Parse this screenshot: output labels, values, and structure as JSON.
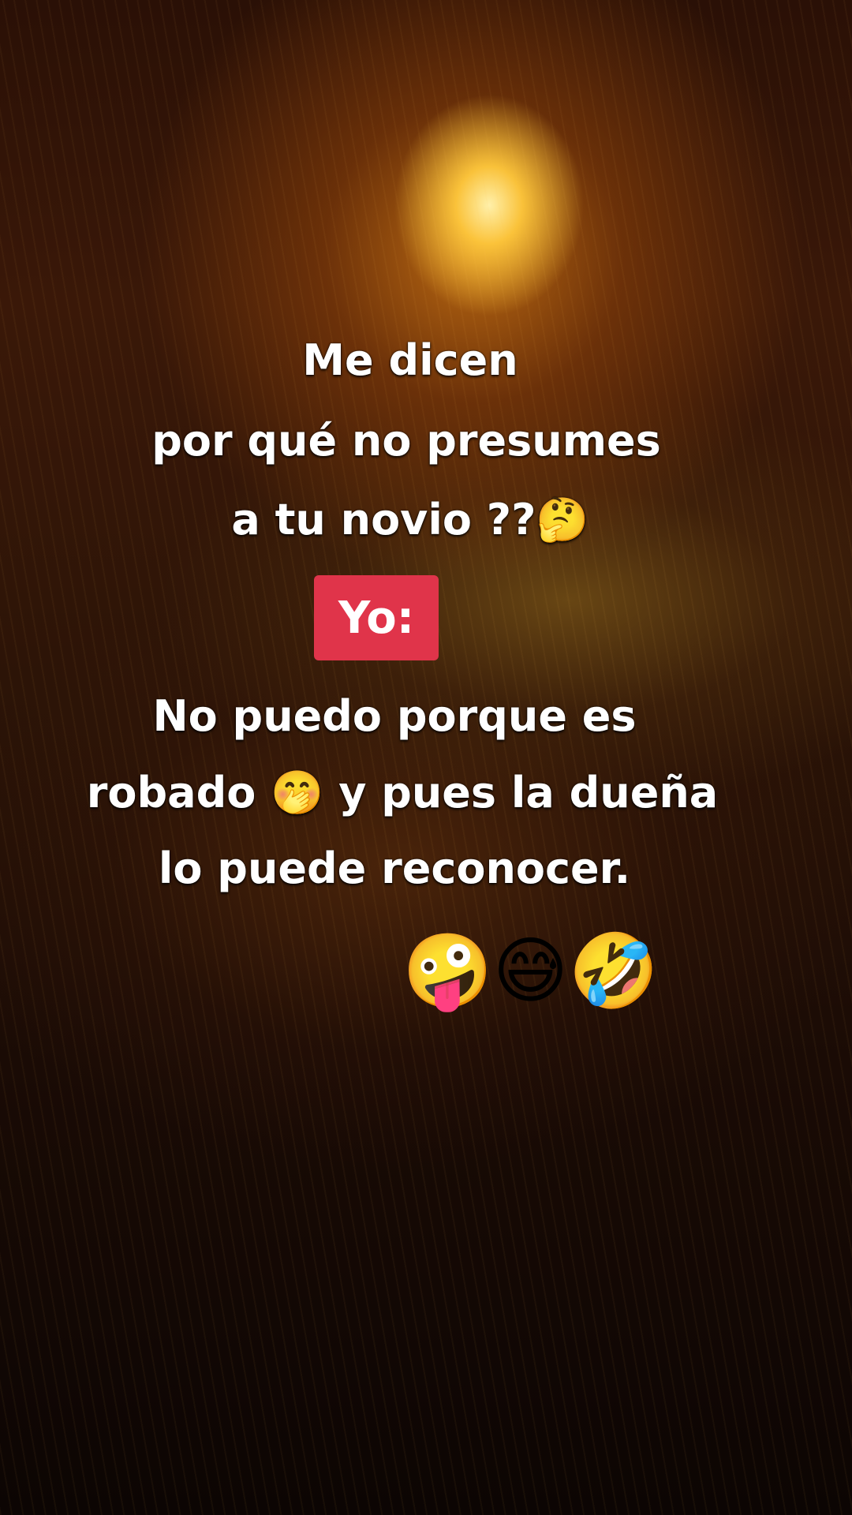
{
  "overlay": {
    "line1": "Me dicen",
    "line2": "por qué no presumes",
    "line3": "a tu novio ??🤔",
    "badge": "Yo:",
    "line4": "No puedo porque es",
    "line5": "robado 🤭 y pues la dueña",
    "line6": "lo puede reconocer.",
    "emojis": "🤪😅🤣"
  },
  "colors": {
    "badge_background": "#e0344a",
    "text": "#ffffff"
  }
}
